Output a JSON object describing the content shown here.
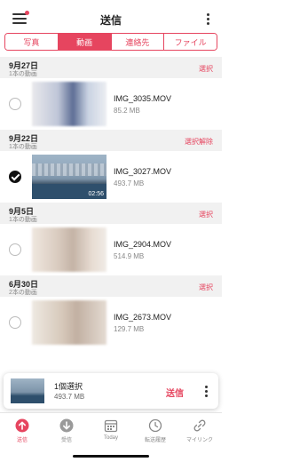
{
  "header": {
    "title": "送信"
  },
  "tabs": [
    {
      "label": "写真",
      "active": false
    },
    {
      "label": "動画",
      "active": true
    },
    {
      "label": "連絡先",
      "active": false
    },
    {
      "label": "ファイル",
      "active": false
    }
  ],
  "sections": [
    {
      "date": "9月27日",
      "count": "1本の動画",
      "action": "選択",
      "items": [
        {
          "name": "IMG_3035.MOV",
          "size": "85.2 MB",
          "selected": false
        }
      ]
    },
    {
      "date": "9月22日",
      "count": "1本の動画",
      "action": "選択解除",
      "items": [
        {
          "name": "IMG_3027.MOV",
          "size": "493.7 MB",
          "selected": true,
          "duration": "02:56"
        }
      ]
    },
    {
      "date": "9月5日",
      "count": "1本の動画",
      "action": "選択",
      "items": [
        {
          "name": "IMG_2904.MOV",
          "size": "514.9 MB",
          "selected": false
        }
      ]
    },
    {
      "date": "6月30日",
      "count": "2本の動画",
      "action": "選択",
      "items": [
        {
          "name": "IMG_2673.MOV",
          "size": "129.7 MB",
          "selected": false
        }
      ]
    }
  ],
  "selection_bar": {
    "count": "1個選択",
    "size": "493.7 MB",
    "send_label": "送信"
  },
  "bottom_nav": [
    {
      "label": "送信",
      "icon": "send-up-arrow-icon",
      "active": true
    },
    {
      "label": "受信",
      "icon": "receive-down-arrow-icon",
      "active": false
    },
    {
      "label": "Today",
      "icon": "today-calendar-icon",
      "active": false
    },
    {
      "label": "転送履歴",
      "icon": "history-clock-icon",
      "active": false
    },
    {
      "label": "マイリンク",
      "icon": "link-icon",
      "active": false
    }
  ],
  "colors": {
    "accent": "#e6455f",
    "section_bg": "#f1f1f1",
    "text_muted": "#888888"
  }
}
